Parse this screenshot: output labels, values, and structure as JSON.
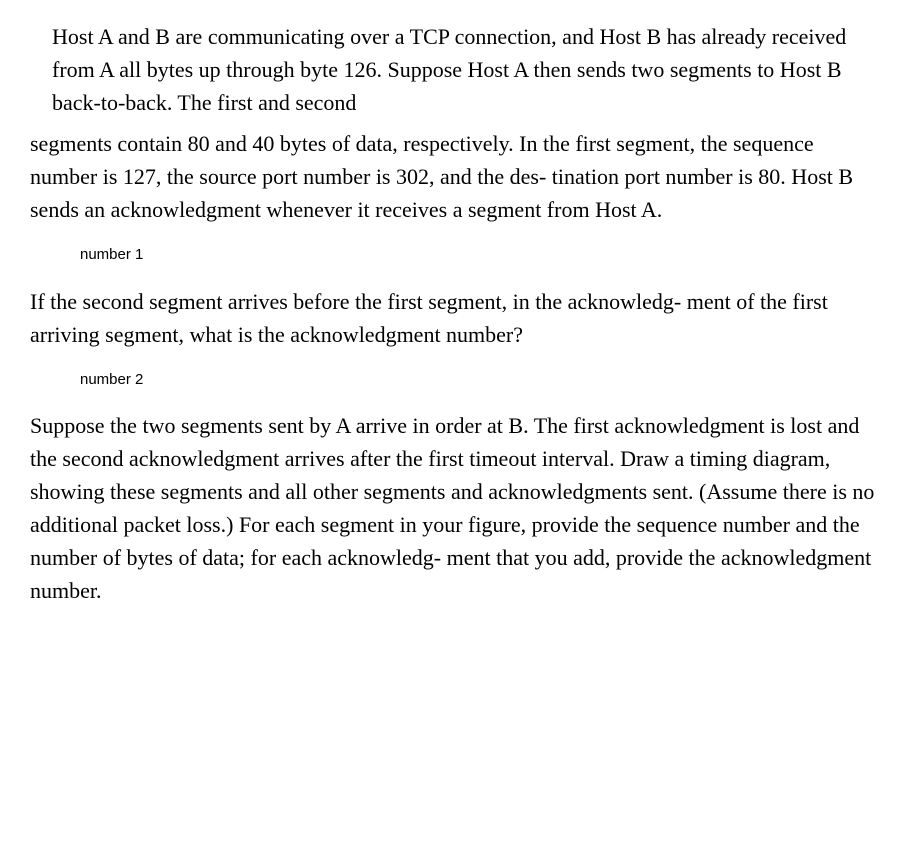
{
  "intro": {
    "p1": "Host A and B are communicating over a TCP connection, and Host B has already received from A all bytes up through byte 126. Suppose Host A then sends two segments to Host B back-to-back. The first and second",
    "p2": "segments contain 80 and 40 bytes of data, respectively. In the first segment, the sequence number is 127, the source port number is 302, and the des- tination port number is 80. Host B sends an acknowledgment whenever it receives a segment from Host A."
  },
  "label1": "number 1",
  "question1": "If the second segment arrives before the first segment, in the acknowledg- ment of the first arriving segment, what is the acknowledgment number?",
  "label2": "number 2",
  "question2": "Suppose the two segments sent by A arrive in order at B. The first acknowledgment is lost and the second acknowledgment arrives after the first timeout interval. Draw a timing diagram, showing these segments and all other segments and acknowledgments sent. (Assume there is no additional packet loss.) For each segment in your figure, provide the sequence number and the number of bytes of data; for each acknowledg- ment that you add, provide the acknowledgment number."
}
